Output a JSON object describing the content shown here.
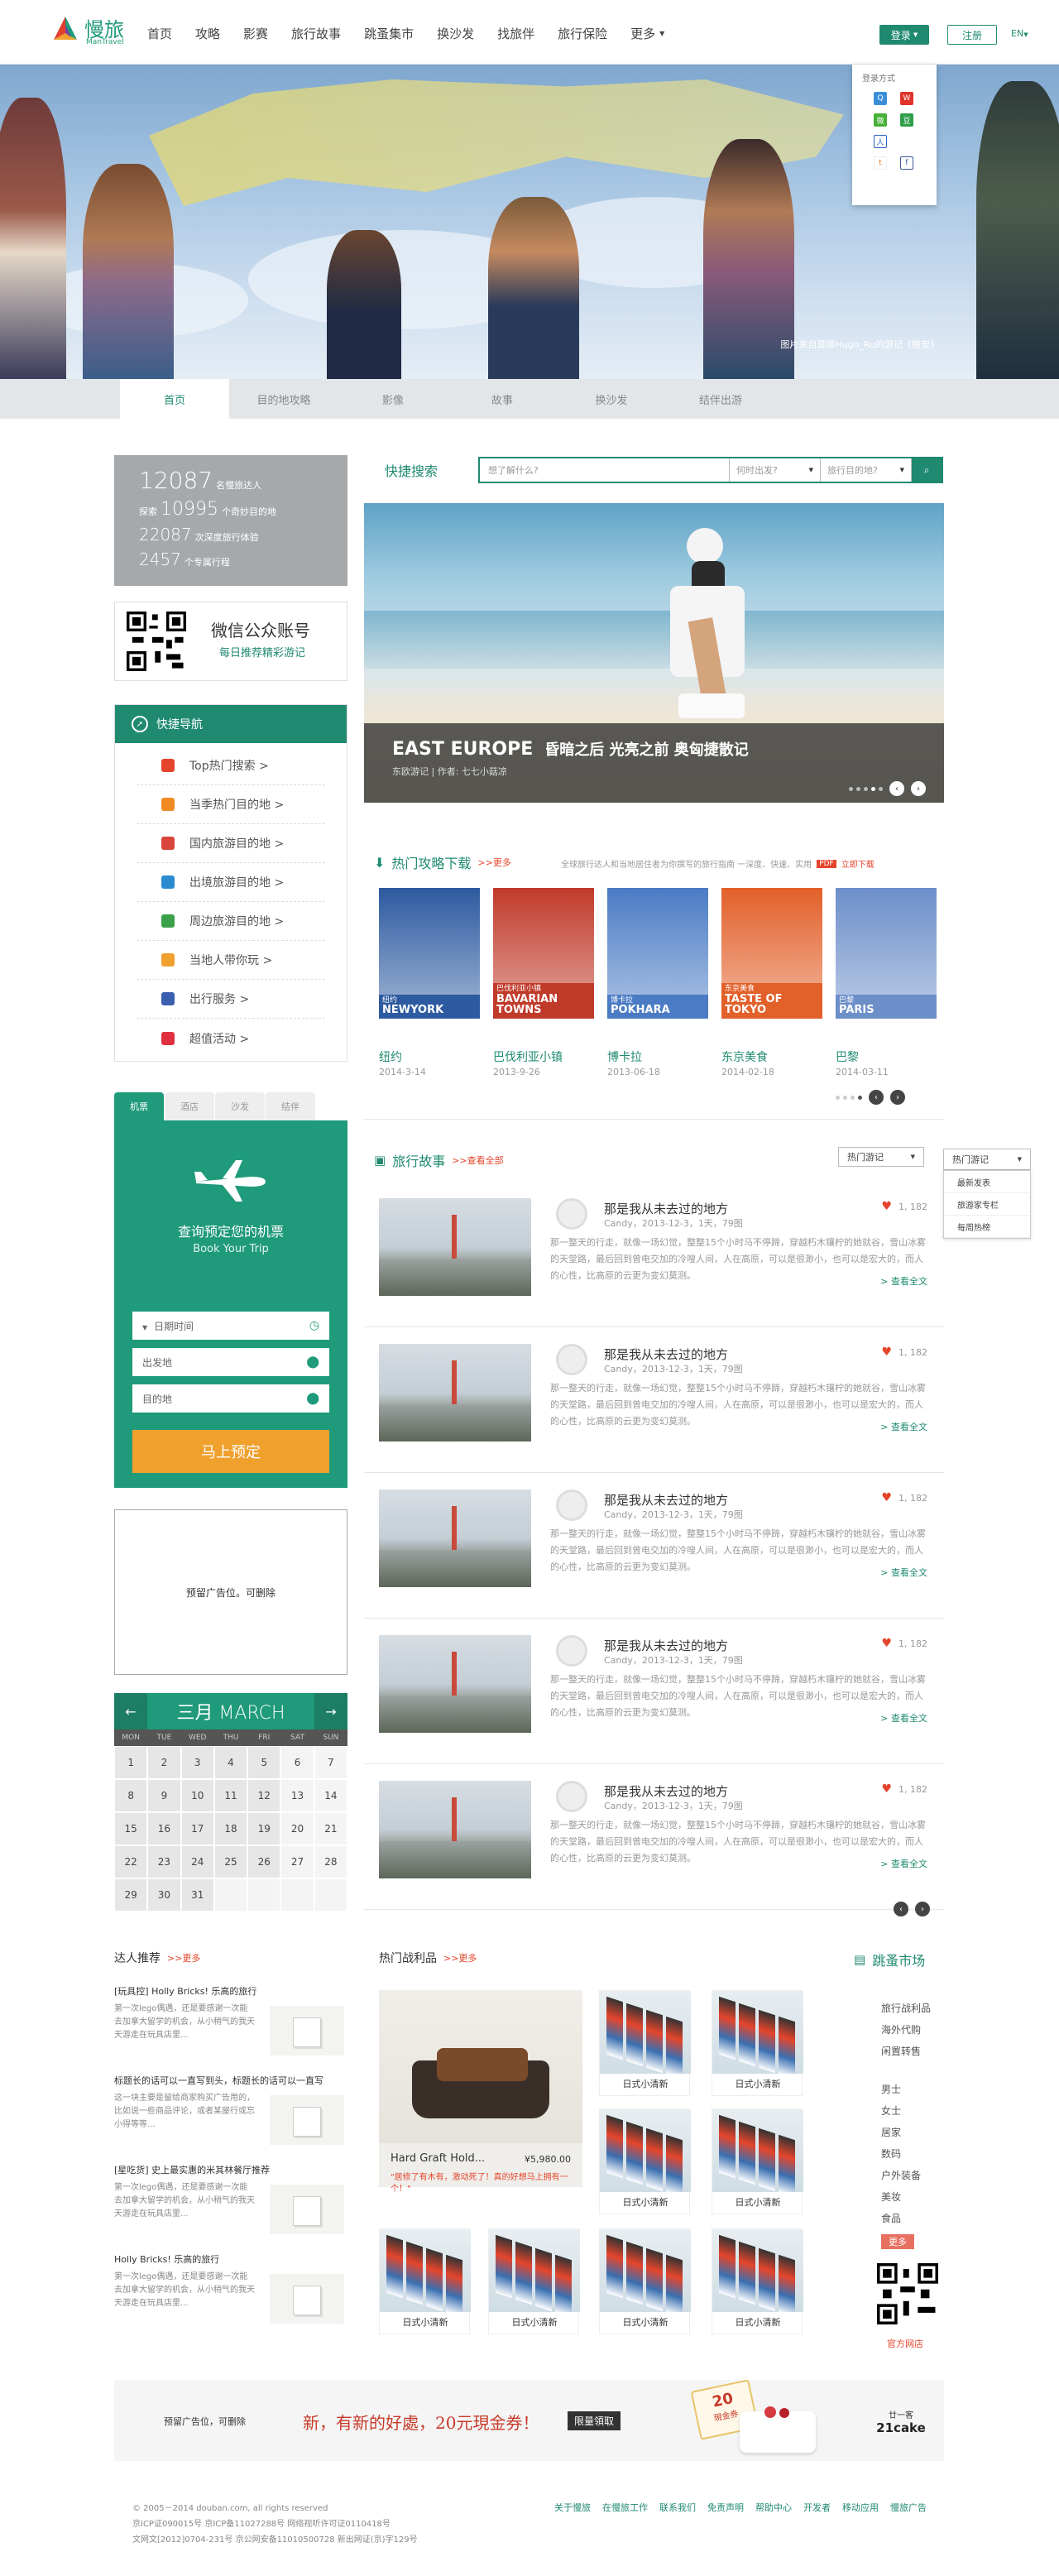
{
  "brand": {
    "name_cn": "慢旅",
    "name_en": "ManTravel"
  },
  "nav": [
    "首页",
    "攻略",
    "影赛",
    "旅行故事",
    "跳蚤集市",
    "换沙发",
    "找旅伴",
    "旅行保险",
    "更多"
  ],
  "header": {
    "login": "登录",
    "register": "注册",
    "lang": "EN"
  },
  "login_popup": {
    "title": "登录方式"
  },
  "hero": {
    "credit": "图片来自莫娜Hugo_Ru的游记《搬安》"
  },
  "subnav": [
    "首页",
    "目的地攻略",
    "影像",
    "故事",
    "换沙发",
    "结伴出游"
  ],
  "stats": [
    {
      "num": "12087",
      "label": "名慢旅达人",
      "size": "big"
    },
    {
      "prefix": "探索",
      "num": "10995",
      "label": "个奇妙目的地",
      "size": "mid"
    },
    {
      "num": "22087",
      "label": "次深度旅行体验",
      "size": "sm"
    },
    {
      "num": "2457",
      "label": "个专属行程",
      "size": "sm"
    }
  ],
  "wechat": {
    "title": "微信公众账号",
    "sub": "每日推荐精彩游记"
  },
  "quick_nav": {
    "title": "快捷导航",
    "items": [
      {
        "label": "Top热门搜索 >",
        "icon": "flag-icon",
        "color": "#e5452c"
      },
      {
        "label": "当季热门目的地 >",
        "icon": "fire-icon",
        "color": "#f08a24"
      },
      {
        "label": "国内旅游目的地 >",
        "icon": "car-icon",
        "color": "#d9453b"
      },
      {
        "label": "出境旅游目的地 >",
        "icon": "globe-icon",
        "color": "#2a8bd1"
      },
      {
        "label": "周边旅游目的地 >",
        "icon": "bike-icon",
        "color": "#3aa14a"
      },
      {
        "label": "当地人带你玩 >",
        "icon": "guide-icon",
        "color": "#f0a02d"
      },
      {
        "label": "出行服务 >",
        "icon": "book-icon",
        "color": "#3a5fb0"
      },
      {
        "label": "超值活动 >",
        "icon": "tag-icon",
        "color": "#e03040"
      }
    ]
  },
  "booking": {
    "tabs": [
      "机票",
      "酒店",
      "沙发",
      "结伴"
    ],
    "headline": "查询预定您的机票",
    "sub": "Book Your Trip",
    "date": "日期时间",
    "from": "出发地",
    "to": "目的地",
    "submit": "马上预定"
  },
  "ad_left": "预留广告位。可删除",
  "calendar": {
    "title": "三月 MARCH",
    "dow": [
      "MON",
      "TUE",
      "WED",
      "THU",
      "FRI",
      "SAT",
      "SUN"
    ],
    "days": [
      "1",
      "2",
      "3",
      "4",
      "5",
      "6",
      "7",
      "8",
      "9",
      "10",
      "11",
      "12",
      "13",
      "14",
      "15",
      "16",
      "17",
      "18",
      "19",
      "20",
      "21",
      "22",
      "23",
      "24",
      "25",
      "26",
      "27",
      "28",
      "29",
      "30",
      "31"
    ]
  },
  "search": {
    "label": "快捷搜索",
    "placeholder": "想了解什么?",
    "when": "何时出发?",
    "where": "旅行目的地?"
  },
  "featured": {
    "title": "EAST EUROPE",
    "subtitle": "昏暗之后 光亮之前 奥匈捷散记",
    "byline": "东欧游记 | 作者: 七七小菇凉"
  },
  "guides_section": {
    "title": "热门攻略下载",
    "more": ">>更多",
    "desc": "全球旅行达人和当地居住者为你撰写的旅行指南 一深度、快速、实用",
    "pdf": "PDF",
    "download": "立即下载",
    "items": [
      {
        "cover": "NEWYORK",
        "cover_cn": "纽约",
        "title": "纽约",
        "date": "2014-3-14",
        "bg": "#2d5aa0"
      },
      {
        "cover": "BAVARIAN TOWNS",
        "cover_cn": "巴伐利亚小镇",
        "title": "巴伐利亚小镇",
        "date": "2013-9-26",
        "bg": "#c03a2a"
      },
      {
        "cover": "POKHARA",
        "cover_cn": "博卡拉",
        "title": "博卡拉",
        "date": "2013-06-18",
        "bg": "#4a7bc4"
      },
      {
        "cover": "TASTE OF TOKYO",
        "cover_cn": "东京美食",
        "title": "东京美食",
        "date": "2014-02-18",
        "bg": "#e2602a"
      },
      {
        "cover": "PARIS",
        "cover_cn": "巴黎",
        "title": "巴黎",
        "date": "2014-03-11",
        "bg": "#6c8ec9"
      }
    ]
  },
  "stories_section": {
    "title": "旅行故事",
    "more": ">>查看全部",
    "dd1": "热门游记",
    "dd2": "热门游记",
    "menu": [
      "最新发表",
      "旅游家专栏",
      "每周热榜"
    ],
    "items": [
      {
        "title": "那是我从未去过的地方",
        "meta": "Candy，2013-12-3，1天，79图",
        "likes": "1, 182",
        "body": "那一整天的行走，就像一场幻觉，整整15个小时马不停蹄，穿越朽木镶柠的她就谷，雪山冰雾的天堂路，最后回到曾电交加的冷嗖人间，人在高原，可以是很渺小，也可以是宏大的，而人的心性，比高原的云更为变幻莫测。",
        "read": "> 查看全文"
      },
      {
        "title": "那是我从未去过的地方",
        "meta": "Candy，2013-12-3，1天，79图",
        "likes": "1, 182",
        "body": "那一整天的行走，就像一场幻觉，整整15个小时马不停蹄，穿越朽木镶柠的她就谷，雪山冰雾的天堂路，最后回到曾电交加的冷嗖人间，人在高原，可以是很渺小，也可以是宏大的，而人的心性，比高原的云更为变幻莫测。",
        "read": "> 查看全文"
      },
      {
        "title": "那是我从未去过的地方",
        "meta": "Candy，2013-12-3，1天，79图",
        "likes": "1, 182",
        "body": "那一整天的行走，就像一场幻觉，整整15个小时马不停蹄，穿越朽木镶柠的她就谷，雪山冰雾的天堂路，最后回到曾电交加的冷嗖人间，人在高原，可以是很渺小，也可以是宏大的，而人的心性，比高原的云更为变幻莫测。",
        "read": "> 查看全文"
      },
      {
        "title": "那是我从未去过的地方",
        "meta": "Candy，2013-12-3，1天，79图",
        "likes": "1, 182",
        "body": "那一整天的行走，就像一场幻觉，整整15个小时马不停蹄，穿越朽木镶柠的她就谷，雪山冰雾的天堂路，最后回到曾电交加的冷嗖人间，人在高原，可以是很渺小，也可以是宏大的，而人的心性，比高原的云更为变幻莫测。",
        "read": "> 查看全文"
      },
      {
        "title": "那是我从未去过的地方",
        "meta": "Candy，2013-12-3，1天，79图",
        "likes": "1, 182",
        "body": "那一整天的行走，就像一场幻觉，整整15个小时马不停蹄，穿越朽木镶柠的她就谷，雪山冰雾的天堂路，最后回到曾电交加的冷嗖人间，人在高原，可以是很渺小，也可以是宏大的，而人的心性，比高原的云更为变幻莫测。",
        "read": "> 查看全文"
      }
    ]
  },
  "experts": {
    "title": "达人推荐",
    "more": ">>更多",
    "items": [
      {
        "title": "[玩具控] Holly Bricks! 乐高的旅行",
        "text": "第一次lego偶遇，还是要感谢一次能去加拿大留学的机会，从小稍气的我天天游走在玩具店里..."
      },
      {
        "title": "标题长的话可以一直写到头，标题长的话可以一直写",
        "text": "这一块主要是留给商家购买广告用的，比如说一些商品评论，或者某屋行或忘小得等等..."
      },
      {
        "title": "[星吃货] 史上最实惠的米其林餐厅推荐",
        "text": "第一次lego偶遇，还是要感谢一次能去加拿大留学的机会，从小稍气的我天天游走在玩具店里..."
      },
      {
        "title": "Holly Bricks! 乐高的旅行",
        "text": "第一次lego偶遇，还是要感谢一次能去加拿大留学的机会，从小稍气的我天天游走在玩具店里..."
      }
    ]
  },
  "products": {
    "title": "热门战利品",
    "more": ">>更多",
    "big": {
      "name": "Hard Graft Hold...",
      "price": "¥5,980.00",
      "desc": "\"居修了有木有，激动死了！真的好想马上拥有一个！\""
    },
    "label": "日式小清新"
  },
  "market": {
    "title": "跳蚤市场",
    "groups": [
      [
        "旅行战利品",
        "海外代购",
        "闲置转售"
      ],
      [
        "男士",
        "女士",
        "居家",
        "数码",
        "户外装备",
        "美妆",
        "食品"
      ]
    ],
    "more": "更多",
    "shop": "官方网店"
  },
  "banner": {
    "ad": "预留广告位，可删除",
    "slogan": "新，有新的好處，20元現金券！",
    "cta": "限量領取",
    "badge": "20",
    "badge_sub": "現金券",
    "brand": "21cake",
    "brand_cn": "廿一客"
  },
  "footer": {
    "lines": [
      "© 2005－2014 douban.com, all rights reserved",
      "京ICP证090015号 京ICP备11027288号 网络视听许可证0110418号",
      "文网文[2012]0704-231号 京公网安备11010500728 新出网证(京)字129号"
    ],
    "links": [
      "关于慢旅",
      "在慢旅工作",
      "联系我们",
      "免责声明",
      "帮助中心",
      "开发者",
      "移动应用",
      "慢旅广告"
    ]
  },
  "colors": {
    "brand": "#1f8a70",
    "accent": "#e5452c",
    "cta": "#f0a02d"
  }
}
